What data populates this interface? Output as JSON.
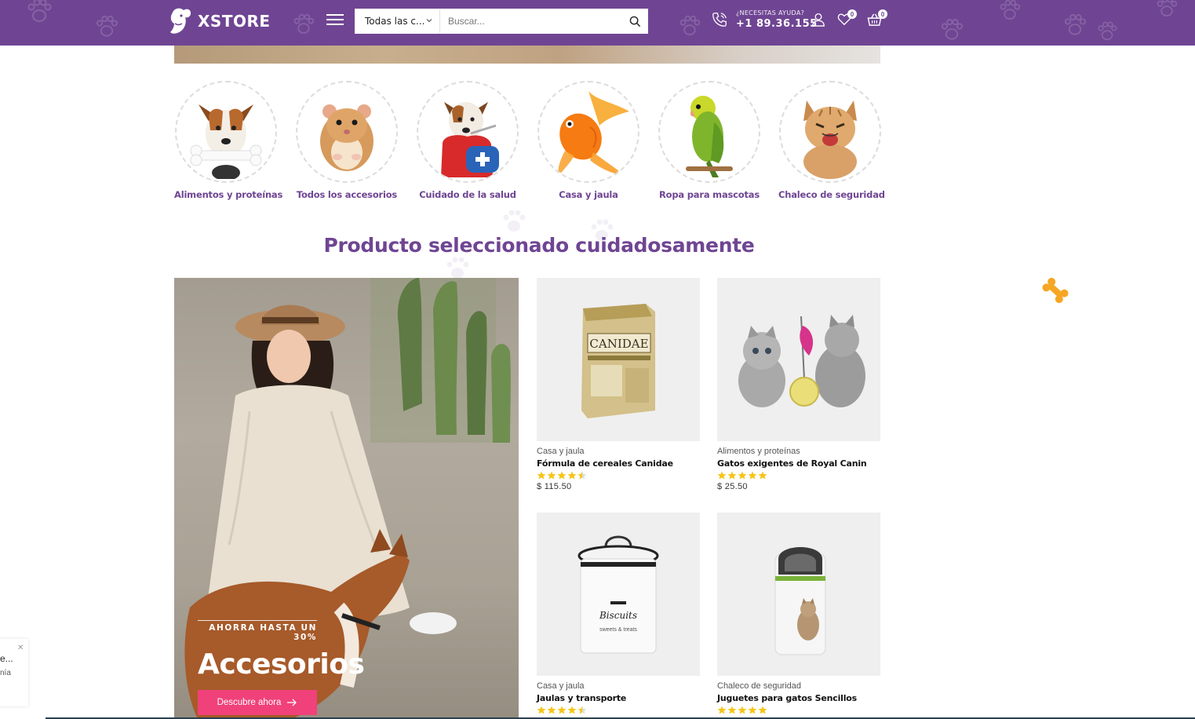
{
  "header": {
    "logo_text": "XSTORE",
    "search": {
      "category": "Todas las c...",
      "placeholder": "Buscar..."
    },
    "help": {
      "caption": "¿NECESITAS AYUDA?",
      "phone": "+1 89.36.155"
    },
    "wishlist_count": "0",
    "cart_count": "0"
  },
  "categories": [
    {
      "label": "Alimentos y proteínas",
      "icon": "dog-bone-image"
    },
    {
      "label": "Todos los accesorios",
      "icon": "hamster-image"
    },
    {
      "label": "Cuidado de la salud",
      "icon": "sick-dog-image"
    },
    {
      "label": "Casa y jaula",
      "icon": "goldfish-image"
    },
    {
      "label": "Ropa para mascotas",
      "icon": "parakeet-image"
    },
    {
      "label": "Chaleco de seguridad",
      "icon": "kitten-image"
    }
  ],
  "section_title": "Producto seleccionado cuidadosamente",
  "promo": {
    "kicker": "AHORRA HASTA UN 30%",
    "title": "Accesorios",
    "button": "Descubre ahora"
  },
  "products": [
    {
      "category": "Casa y jaula",
      "name": "Fórmula de cereales Canidae",
      "price": "$ 115.50",
      "rating": 4.5,
      "image": "canidae-bag-image"
    },
    {
      "category": "Alimentos y proteínas",
      "name": "Gatos exigentes de Royal Canin",
      "price": "$ 25.50",
      "rating": 5,
      "image": "kittens-toy-image"
    },
    {
      "category": "Casa y jaula",
      "name": "Jaulas y transporte",
      "price": "",
      "rating": 4.5,
      "image": "biscuits-jar-image"
    },
    {
      "category": "Chaleco de seguridad",
      "name": "Juguetes para gatos Sencillos",
      "price": "",
      "rating": 5,
      "image": "food-dispenser-image"
    }
  ],
  "toast": {
    "line1": "e...",
    "line2": "nía"
  },
  "colors": {
    "brand": "#6f4593",
    "accent": "#f0417a",
    "star": "#f5c518",
    "bone": "#f5a623"
  }
}
